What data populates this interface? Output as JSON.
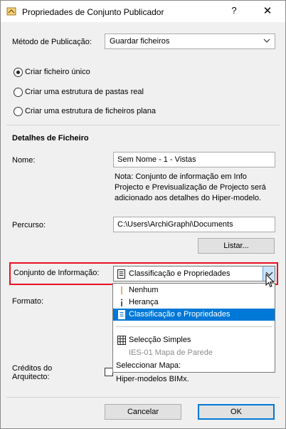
{
  "window": {
    "title": "Propriedades de Conjunto Publicador",
    "help_label": "?",
    "close_label": "✕"
  },
  "method": {
    "label": "Método de Publicação:",
    "value": "Guardar ficheiros"
  },
  "radios": [
    {
      "label": "Criar ficheiro único",
      "checked": true
    },
    {
      "label": "Criar uma estrutura de pastas real",
      "checked": false
    },
    {
      "label": "Criar uma estrutura de ficheiros plana",
      "checked": false
    }
  ],
  "details": {
    "heading": "Detalhes de Ficheiro",
    "name_label": "Nome:",
    "name_value": "Sem Nome - 1 - Vistas",
    "note_line1": "Nota: Conjunto de informação em Info",
    "note_line2": "Projecto e Previsualização de Projecto será",
    "note_line3": "adicionado aos detalhes do Hiper-modelo.",
    "path_label": "Percurso:",
    "path_value": "C:\\Users\\ArchiGraphi\\Documents",
    "list_button": "Listar..."
  },
  "info_set": {
    "label": "Conjunto de Informação:",
    "value": "Classificação e Propriedades"
  },
  "format_label": "Formato:",
  "credits": {
    "label_line1": "Créditos do",
    "label_line2": "Arquitecto:",
    "text": "Hiper-modelos BIMx."
  },
  "dropdown": {
    "items": [
      {
        "label": "Nenhum",
        "icon": "i-cursor-icon"
      },
      {
        "label": "Herança",
        "icon": "info-icon"
      },
      {
        "label": "Classificação e Propriedades",
        "icon": "document-list-icon",
        "selected": true
      },
      {
        "label": "Selecção Simples",
        "icon": "table-grid-icon"
      },
      {
        "label": "IES-01 Mapa de Parede",
        "disabled": true
      },
      {
        "label": "Seleccionar Mapa:"
      }
    ]
  },
  "buttons": {
    "cancel": "Cancelar",
    "ok": "OK"
  },
  "colors": {
    "highlight_border": "#e81123",
    "selection": "#0078d7"
  }
}
